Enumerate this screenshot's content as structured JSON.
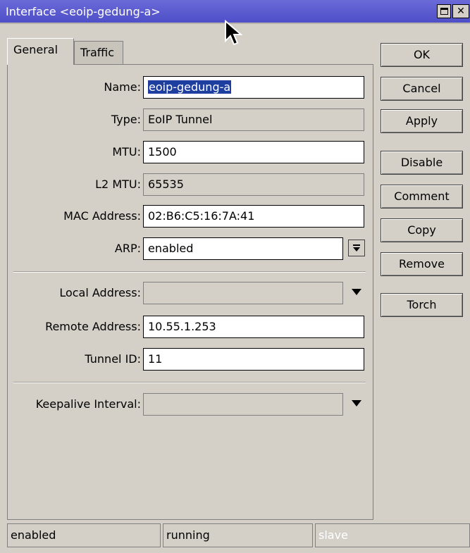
{
  "window": {
    "title": "Interface <eoip-gedung-a>"
  },
  "tabs": [
    {
      "label": "General"
    },
    {
      "label": "Traffic"
    }
  ],
  "form": {
    "name": {
      "label": "Name:",
      "value": "eoip-gedung-a"
    },
    "type": {
      "label": "Type:",
      "value": "EoIP Tunnel"
    },
    "mtu": {
      "label": "MTU:",
      "value": "1500"
    },
    "l2mtu": {
      "label": "L2 MTU:",
      "value": "65535"
    },
    "mac": {
      "label": "MAC Address:",
      "value": "02:B6:C5:16:7A:41"
    },
    "arp": {
      "label": "ARP:",
      "value": "enabled"
    },
    "local_address": {
      "label": "Local Address:",
      "value": ""
    },
    "remote_address": {
      "label": "Remote Address:",
      "value": "10.55.1.253"
    },
    "tunnel_id": {
      "label": "Tunnel ID:",
      "value": "11"
    },
    "keepalive": {
      "label": "Keepalive Interval:",
      "value": ""
    }
  },
  "buttons": {
    "ok": "OK",
    "cancel": "Cancel",
    "apply": "Apply",
    "disable": "Disable",
    "comment": "Comment",
    "copy": "Copy",
    "remove": "Remove",
    "torch": "Torch"
  },
  "status": {
    "state": "enabled",
    "running": "running",
    "slave": "slave"
  },
  "colors": {
    "titlebar": "#4e4ec8",
    "selection": "#1e3ea0",
    "background": "#d4d0c8"
  }
}
